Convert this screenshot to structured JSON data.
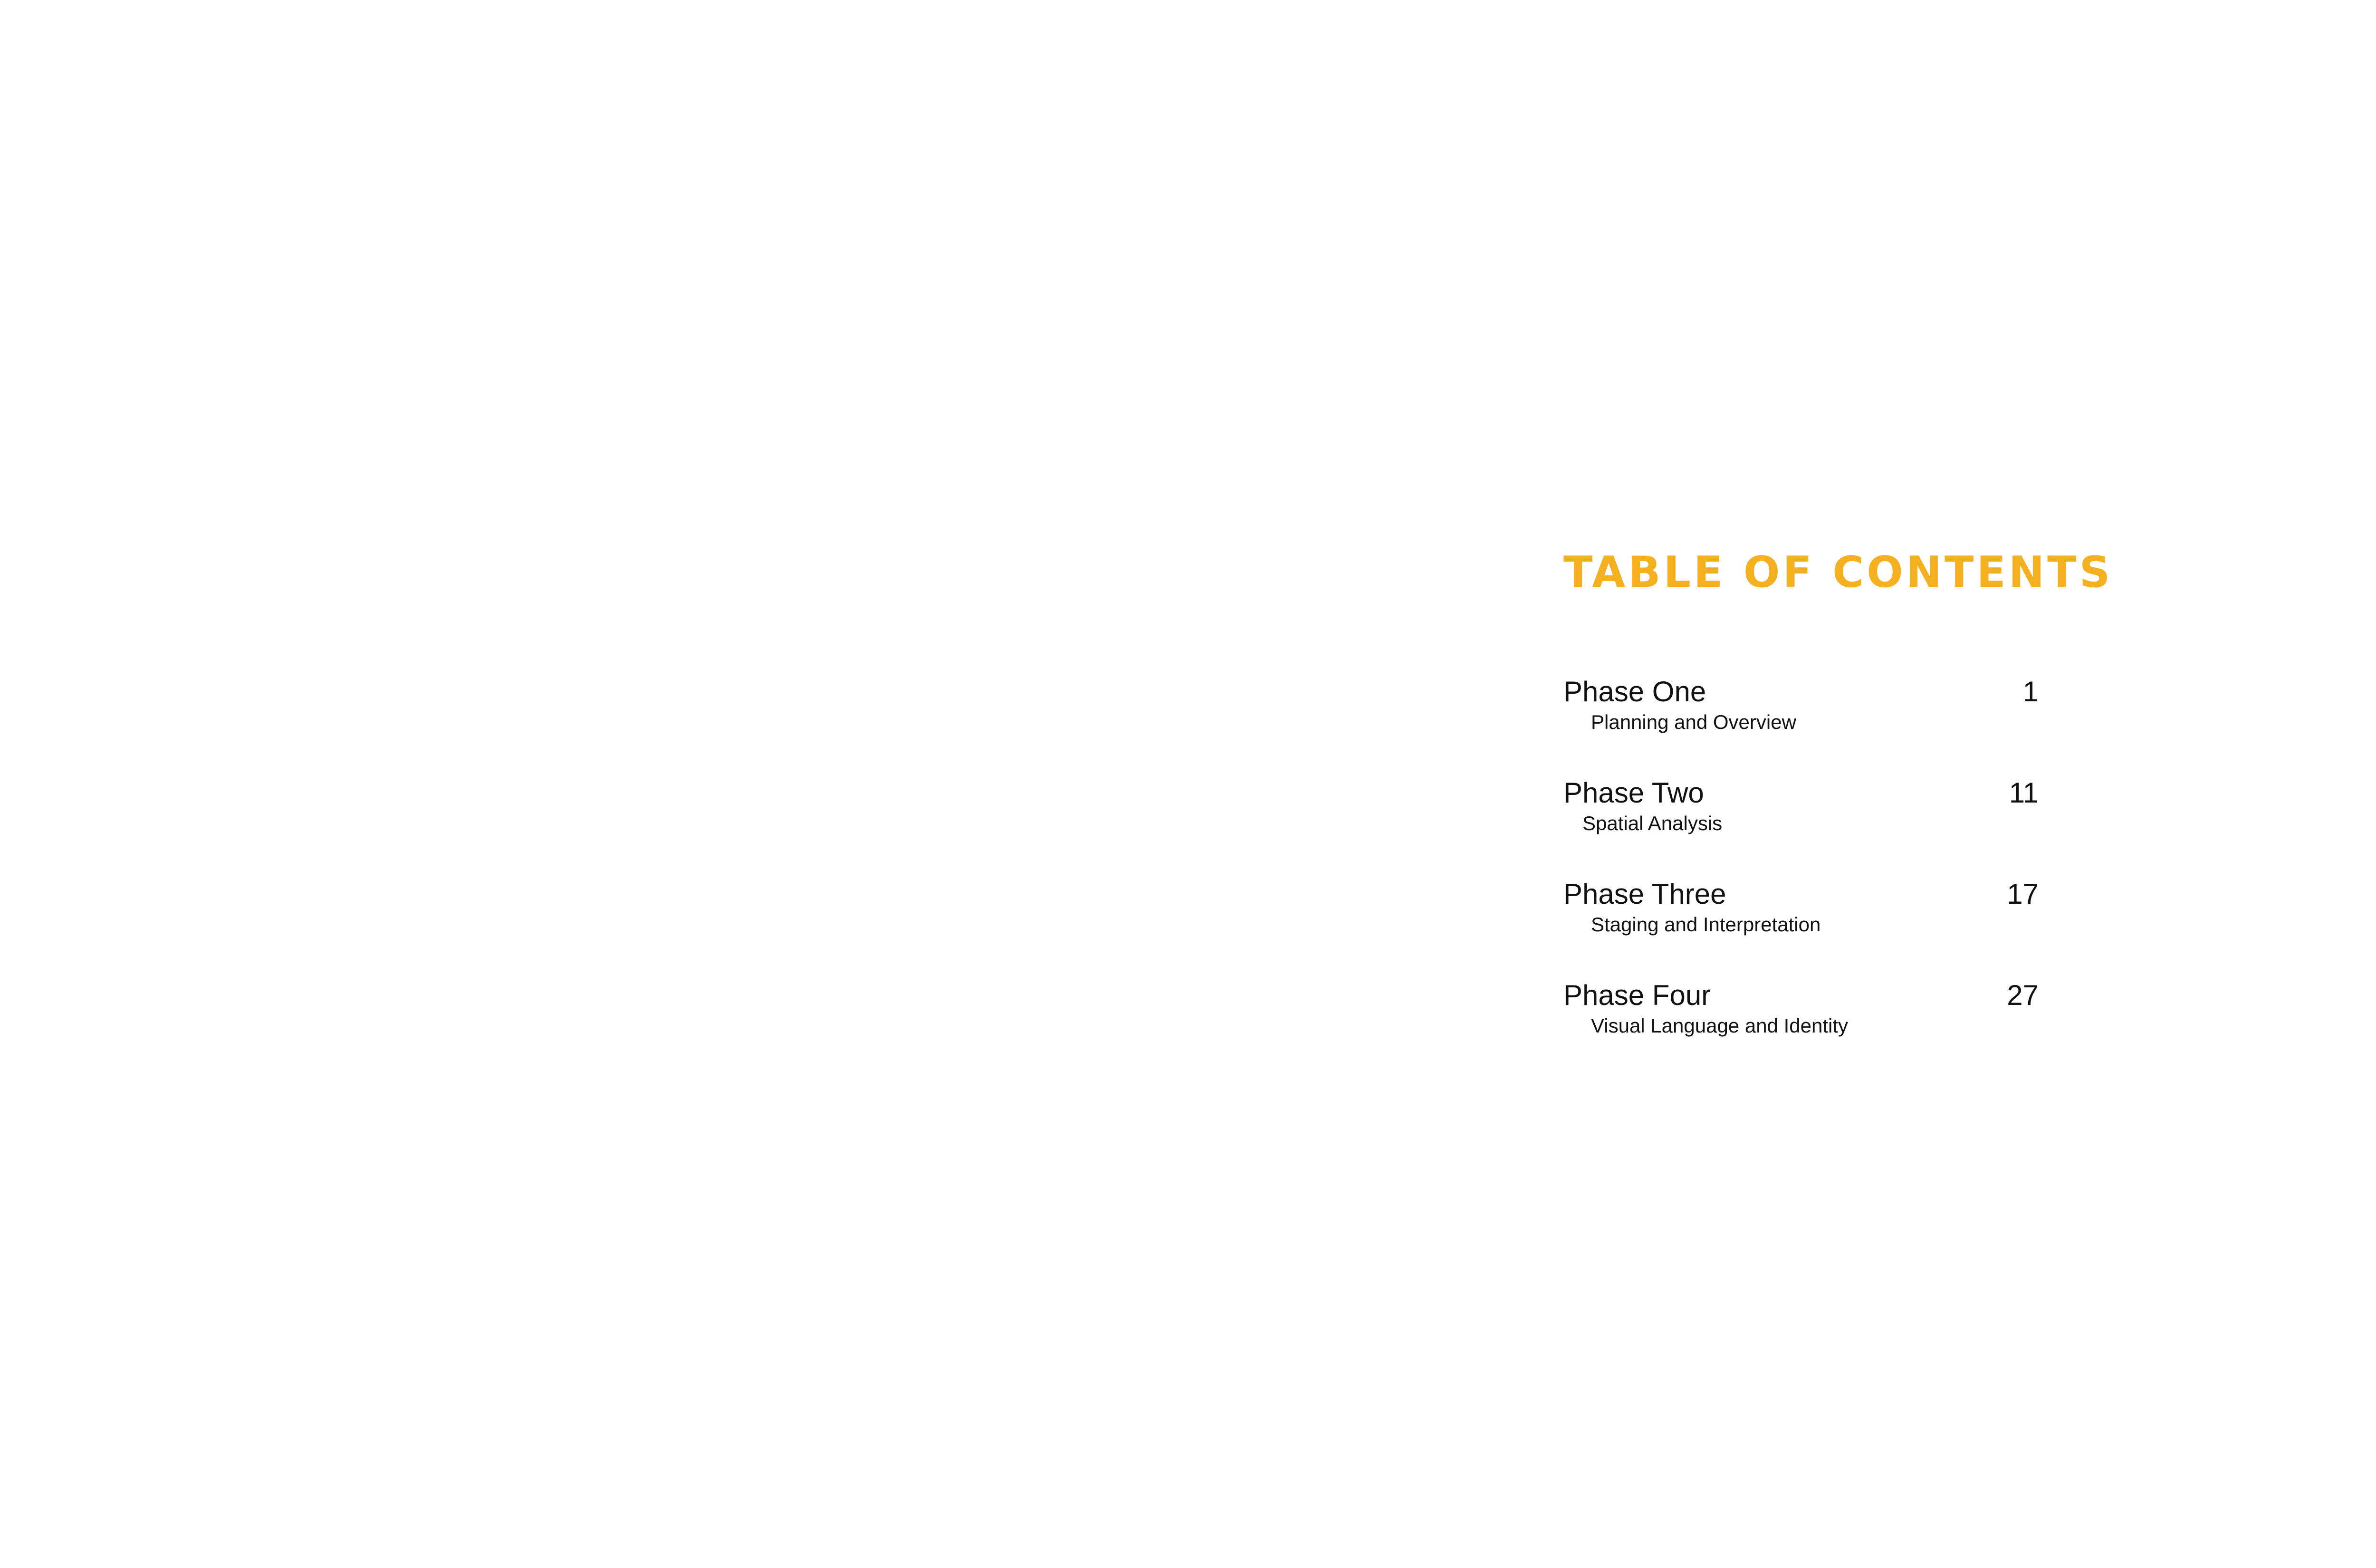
{
  "document": {
    "title": "TABLE OF CONTENTS",
    "accent_color": "#f5b01f",
    "text_color": "#111111"
  },
  "toc": {
    "entries": [
      {
        "title": "Phase One",
        "subtitle": "Planning and Overview",
        "page": "1"
      },
      {
        "title": "Phase Two",
        "subtitle": "Spatial Analysis",
        "page": "11"
      },
      {
        "title": "Phase Three",
        "subtitle": "Staging and Interpretation",
        "page": "17"
      },
      {
        "title": "Phase Four",
        "subtitle": "Visual Language and Identity",
        "page": "27"
      }
    ]
  }
}
